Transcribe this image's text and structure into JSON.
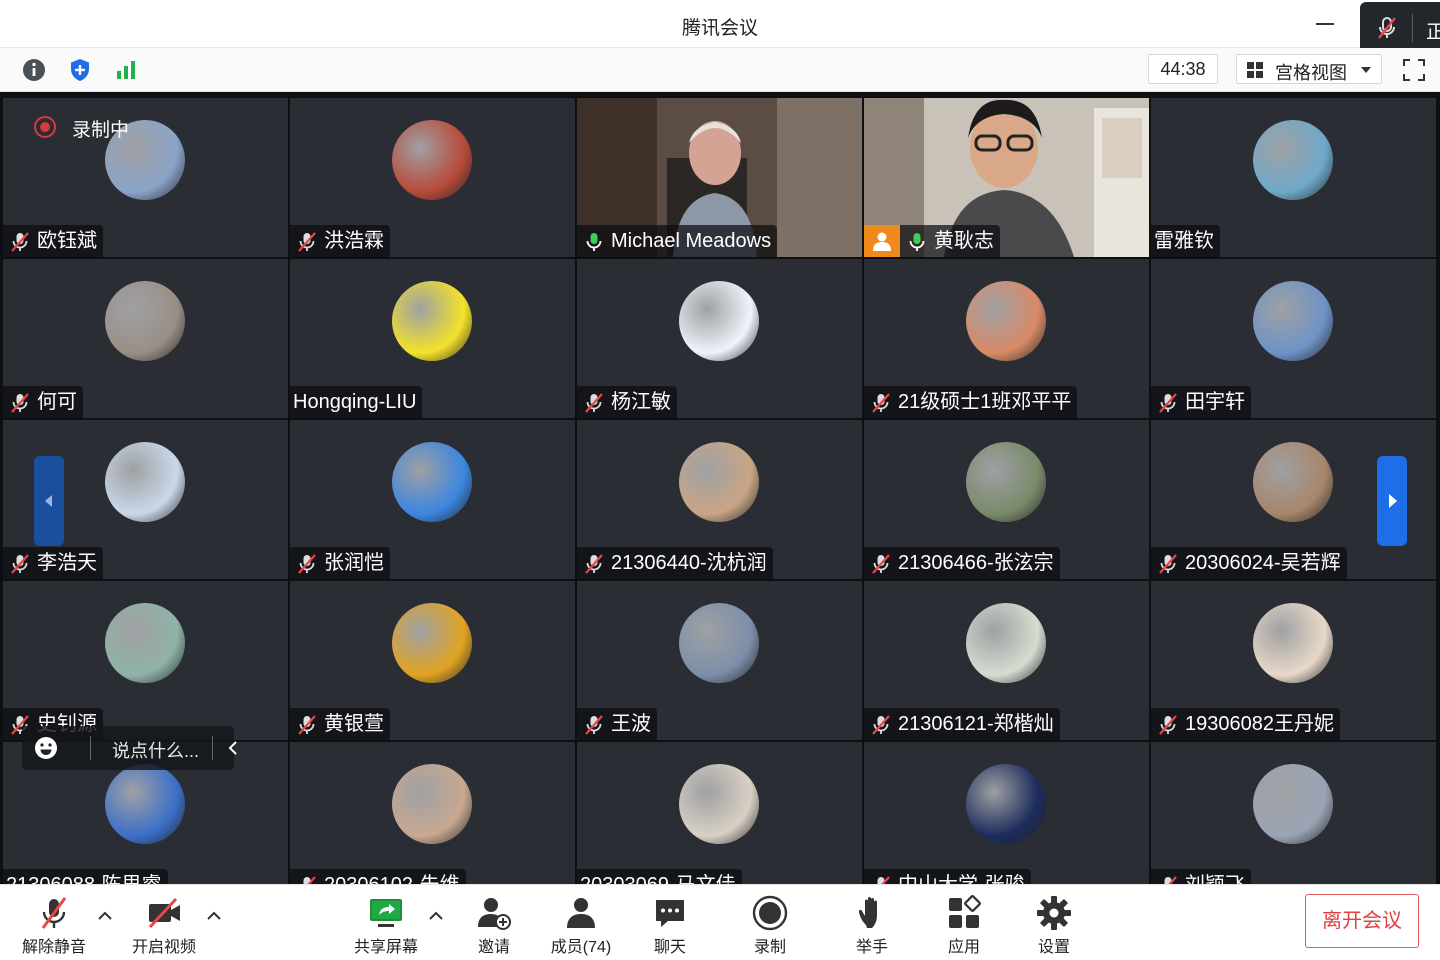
{
  "window": {
    "title": "腾讯会议",
    "speaking_indicator_text": "正"
  },
  "toolbar": {
    "timer": "44:38",
    "view_label": "宫格视图"
  },
  "recording": {
    "label": "录制中"
  },
  "chat": {
    "placeholder": "说点什么..."
  },
  "participants": [
    {
      "name": "欧钰斌",
      "mic": "muted",
      "avatar_color": "#8aa4c8"
    },
    {
      "name": "洪浩霖",
      "mic": "muted",
      "avatar_color": "#b84a3a"
    },
    {
      "name": "Michael Meadows",
      "mic": "on",
      "video": true,
      "speaking": true
    },
    {
      "name": "黄耿志",
      "mic": "on",
      "video": true,
      "host": true
    },
    {
      "name": "雷雅钦",
      "mic": "none",
      "avatar_color": "#6fa9c9"
    },
    {
      "name": "何可",
      "mic": "muted",
      "avatar_color": "#9a8f86"
    },
    {
      "name": "Hongqing-LIU",
      "mic": "none",
      "avatar_color": "#f4e22a"
    },
    {
      "name": "杨江敏",
      "mic": "muted",
      "avatar_color": "#eef4fb"
    },
    {
      "name": "21级硕士1班邓平平",
      "mic": "muted",
      "avatar_color": "#d98a66"
    },
    {
      "name": "田宇轩",
      "mic": "muted",
      "avatar_color": "#6e93c7"
    },
    {
      "name": "李浩天",
      "mic": "muted",
      "avatar_color": "#c9d8ea"
    },
    {
      "name": "张润恺",
      "mic": "muted",
      "avatar_color": "#3c86e0"
    },
    {
      "name": "21306440-沈杭润",
      "mic": "muted",
      "avatar_color": "#c9a585"
    },
    {
      "name": "21306466-张泫宗",
      "mic": "muted",
      "avatar_color": "#7a8a6a"
    },
    {
      "name": "20306024-吴若辉",
      "mic": "muted",
      "avatar_color": "#a8866a"
    },
    {
      "name": "史钊源",
      "mic": "muted",
      "avatar_color": "#8fb3a8"
    },
    {
      "name": "黄银萱",
      "mic": "muted",
      "avatar_color": "#e0a422"
    },
    {
      "name": "王波",
      "mic": "muted",
      "avatar_color": "#7c8fa8"
    },
    {
      "name": "21306121-郑楷灿",
      "mic": "muted",
      "avatar_color": "#d4ddd0"
    },
    {
      "name": "19306082王丹妮",
      "mic": "muted",
      "avatar_color": "#e8d8c8"
    },
    {
      "name": "21306088-陈思睿",
      "mic": "none",
      "avatar_color": "#3c6fc8"
    },
    {
      "name": "20306102-朱维",
      "mic": "muted",
      "avatar_color": "#c8a890"
    },
    {
      "name": "20303069-马文佳",
      "mic": "none",
      "avatar_color": "#d8d0c4"
    },
    {
      "name": "中山大学-张骏",
      "mic": "muted",
      "avatar_color": "#1c2c5c"
    },
    {
      "name": "刘颖飞",
      "mic": "muted",
      "avatar_color": "#9aa4b4"
    }
  ],
  "bottombar": {
    "unmute": "解除静音",
    "start_video": "开启视频",
    "share_screen": "共享屏幕",
    "invite": "邀请",
    "members": "成员(74)",
    "chat": "聊天",
    "record": "录制",
    "raise_hand": "举手",
    "apps": "应用",
    "settings": "设置",
    "leave": "离开会议"
  },
  "colors": {
    "accent_blue": "#1e6ee8",
    "active_speaker_green": "#2fbf4a",
    "leave_red": "#e0403f",
    "tile_bg": "#2a2d33"
  }
}
